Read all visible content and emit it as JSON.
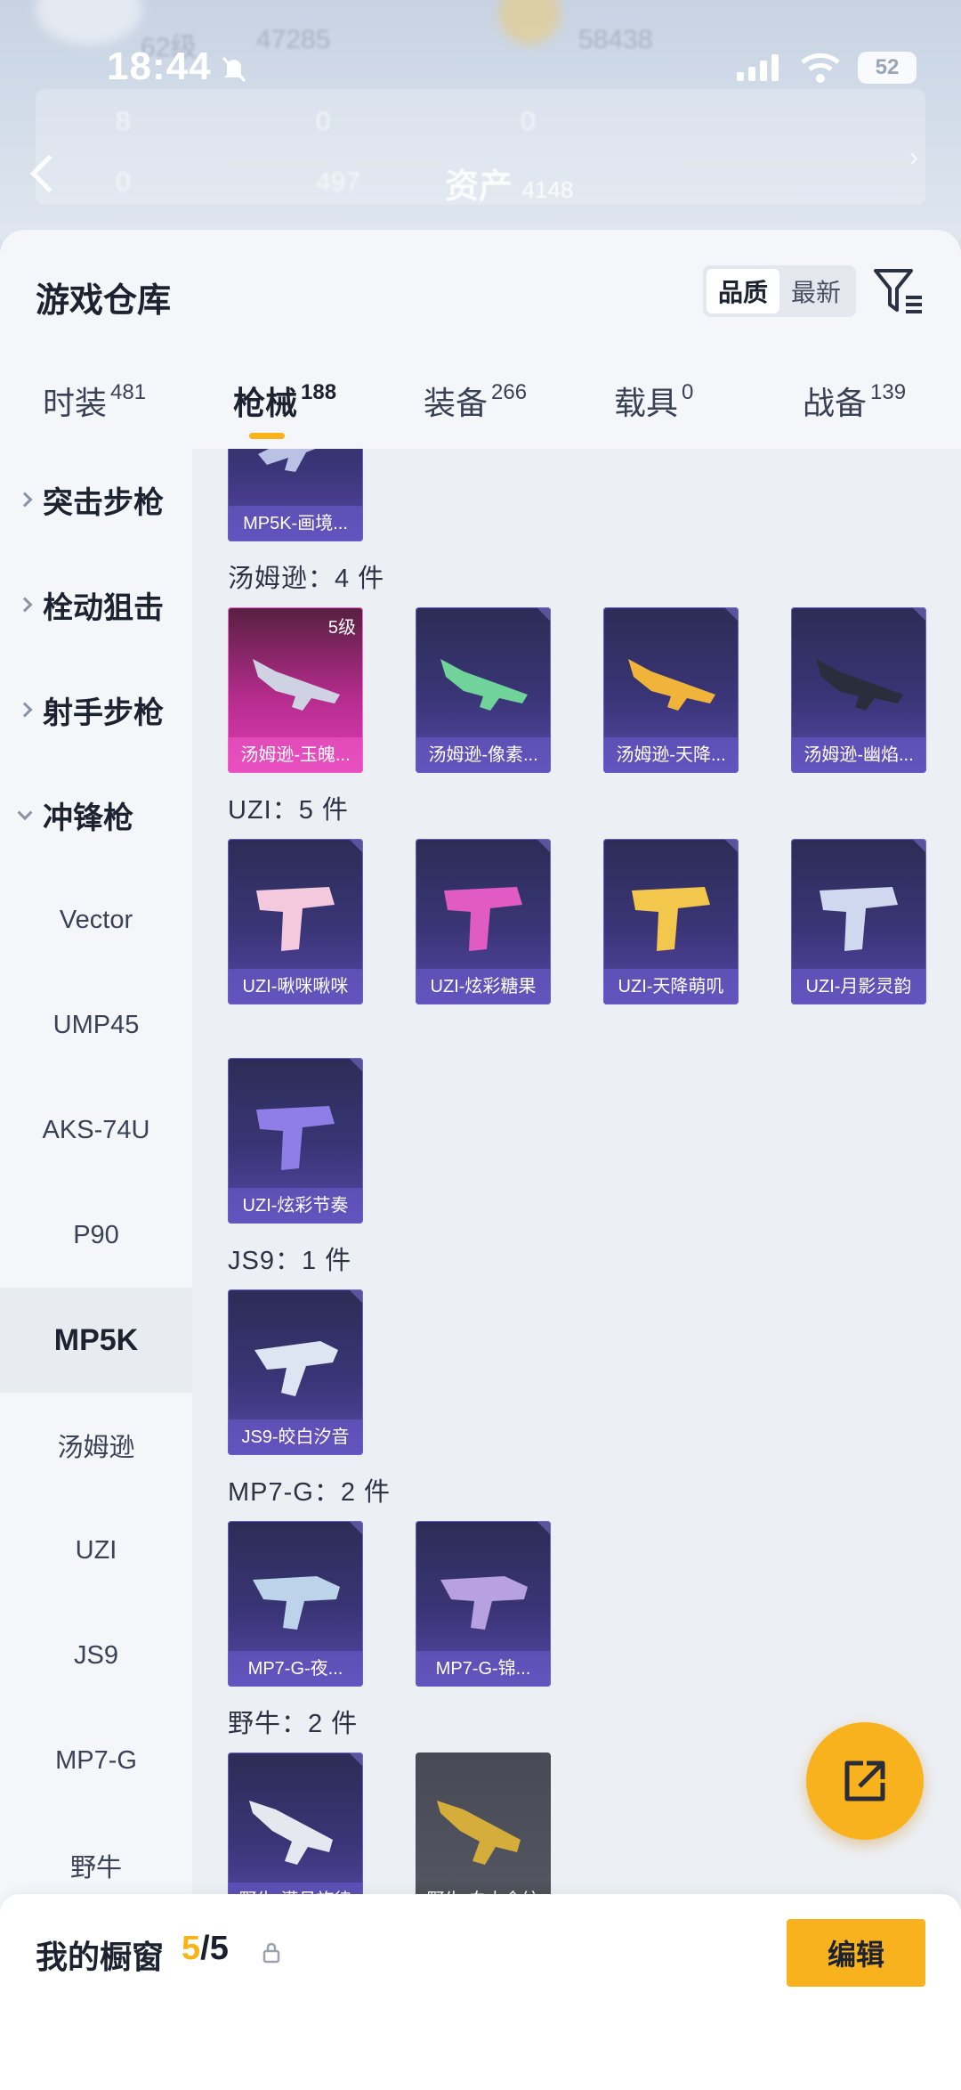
{
  "status": {
    "time": "18:44",
    "battery": "52"
  },
  "background": {
    "assets_label": "资产",
    "ghost_texts": [
      "62级",
      "47285",
      "58438",
      "8",
      "0",
      "0",
      "0",
      "497",
      "4148"
    ]
  },
  "header": {
    "title": "游戏仓库",
    "sort_options": [
      "品质",
      "最新"
    ],
    "sort_selected": "品质"
  },
  "tabs": [
    {
      "label": "时装",
      "count": "481"
    },
    {
      "label": "枪械",
      "count": "188"
    },
    {
      "label": "装备",
      "count": "266"
    },
    {
      "label": "载具",
      "count": "0"
    },
    {
      "label": "战备",
      "count": "139"
    }
  ],
  "sidebar": {
    "categories": [
      {
        "label": "突击步枪"
      },
      {
        "label": "栓动狙击"
      },
      {
        "label": "射手步枪"
      },
      {
        "label": "冲锋枪"
      }
    ],
    "items": [
      "Vector",
      "UMP45",
      "AKS-74U",
      "P90",
      "MP5K",
      "汤姆逊",
      "UZI",
      "JS9",
      "MP7-G",
      "野牛"
    ],
    "selected": "MP5K"
  },
  "content": {
    "partial_top": {
      "name": "MP5K-画境..."
    },
    "groups": [
      {
        "label": "汤姆逊：4 件",
        "items": [
          {
            "name": "汤姆逊-玉魄...",
            "level": "5级",
            "rarity": "pink"
          },
          {
            "name": "汤姆逊-像素..."
          },
          {
            "name": "汤姆逊-天降..."
          },
          {
            "name": "汤姆逊-幽焰..."
          }
        ]
      },
      {
        "label": "UZI：5 件",
        "items": [
          {
            "name": "UZI-啾咪啾咪"
          },
          {
            "name": "UZI-炫彩糖果"
          },
          {
            "name": "UZI-天降萌叽"
          },
          {
            "name": "UZI-月影灵韵"
          },
          {
            "name": "UZI-炫彩节奏"
          }
        ]
      },
      {
        "label": "JS9：1 件",
        "items": [
          {
            "name": "JS9-皎白汐音"
          }
        ]
      },
      {
        "label": "MP7-G：2 件",
        "items": [
          {
            "name": "MP7-G-夜..."
          },
          {
            "name": "MP7-G-锦..."
          }
        ]
      },
      {
        "label": "野牛：2 件",
        "items": [
          {
            "name": "野牛-满月旋律"
          },
          {
            "name": "野牛-白木金纹",
            "rarity": "gray"
          }
        ]
      }
    ]
  },
  "bottom": {
    "title": "我的橱窗",
    "count_current": "5",
    "count_total": "/5",
    "edit_label": "编辑"
  },
  "colors": {
    "accent": "#f8b21d",
    "card_purple": "#3a3577",
    "card_pink": "#de3fb4"
  }
}
